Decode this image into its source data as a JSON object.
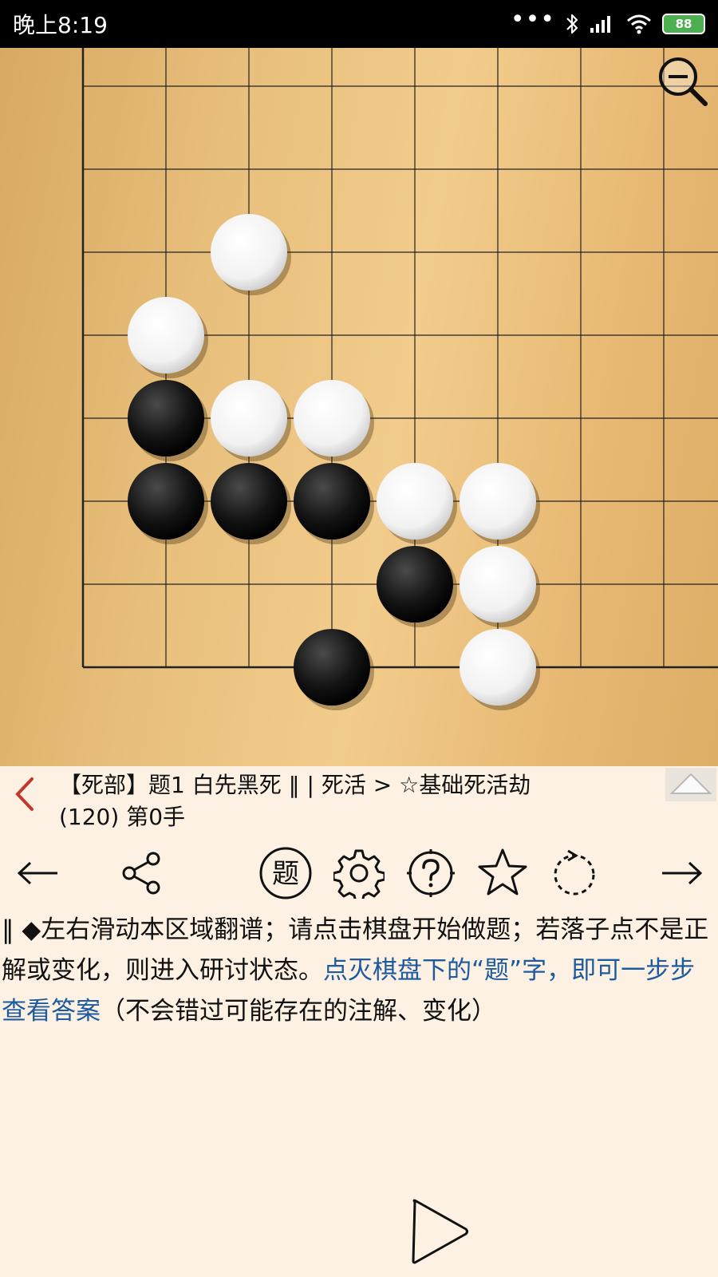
{
  "status_bar": {
    "time": "晚上8:19",
    "battery": "88"
  },
  "board": {
    "size": 19,
    "visible_columns": 8,
    "visible_rows": 8,
    "stones": [
      {
        "color": "white",
        "col": 2,
        "row": 2
      },
      {
        "color": "white",
        "col": 1,
        "row": 3
      },
      {
        "color": "black",
        "col": 1,
        "row": 4
      },
      {
        "color": "white",
        "col": 2,
        "row": 4
      },
      {
        "color": "white",
        "col": 3,
        "row": 4
      },
      {
        "color": "black",
        "col": 1,
        "row": 5
      },
      {
        "color": "black",
        "col": 2,
        "row": 5
      },
      {
        "color": "black",
        "col": 3,
        "row": 5
      },
      {
        "color": "white",
        "col": 4,
        "row": 5
      },
      {
        "color": "white",
        "col": 5,
        "row": 5
      },
      {
        "color": "black",
        "col": 4,
        "row": 6
      },
      {
        "color": "white",
        "col": 5,
        "row": 6
      },
      {
        "color": "black",
        "col": 3,
        "row": 7
      },
      {
        "color": "white",
        "col": 5,
        "row": 7
      }
    ]
  },
  "problem": {
    "title_line1": "【死部】题1 白先黑死 ‖ | 死活 > ☆基础死活劫",
    "title_line2": "(120) 第0手"
  },
  "toolbar": {
    "problem_char": "题"
  },
  "description": {
    "part1": "‖ ◆左右滑动本区域翻谱；请点击棋盘开始做题；若落子点不是正解或变化，则进入研讨状态。",
    "highlight": "点灭棋盘下的“题”字，即可一步步查看答案",
    "part2": "（不会错过可能存在的注解、变化）"
  },
  "colors": {
    "background": "#fdf1e3",
    "highlight_text": "#1e5a9e",
    "back_arrow": "#c0392b"
  }
}
